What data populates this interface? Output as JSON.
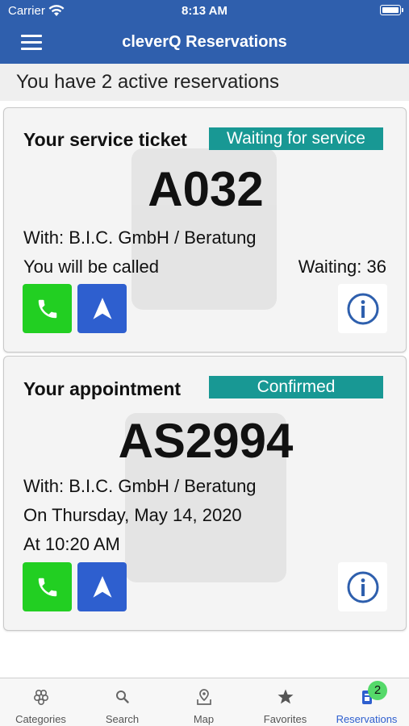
{
  "status_bar": {
    "carrier": "Carrier",
    "time": "8:13 AM"
  },
  "nav": {
    "title": "cleverQ Reservations"
  },
  "summary": {
    "text": "You have 2 active reservations"
  },
  "colors": {
    "primary": "#2f5fad",
    "badge": "#189894",
    "call": "#22cf22",
    "navigate": "#2e5fcf",
    "active_tab": "#2e5fcf"
  },
  "reservations": [
    {
      "heading": "Your service ticket",
      "status": "Waiting for service",
      "number": "A032",
      "with": "With: B.I.C. GmbH / Beratung",
      "call_note": "You will be called",
      "waiting": "Waiting: 36"
    },
    {
      "heading": "Your appointment",
      "status": "Confirmed",
      "number": "AS2994",
      "with": "With: B.I.C. GmbH / Beratung",
      "date": "On Thursday, May 14, 2020",
      "time": "At 10:20 AM"
    }
  ],
  "tabs": [
    {
      "label": "Categories",
      "icon": "categories-icon"
    },
    {
      "label": "Search",
      "icon": "search-icon"
    },
    {
      "label": "Map",
      "icon": "map-icon"
    },
    {
      "label": "Favorites",
      "icon": "star-icon"
    },
    {
      "label": "Reservations",
      "icon": "reservations-icon",
      "active": true,
      "badge": "2"
    }
  ]
}
